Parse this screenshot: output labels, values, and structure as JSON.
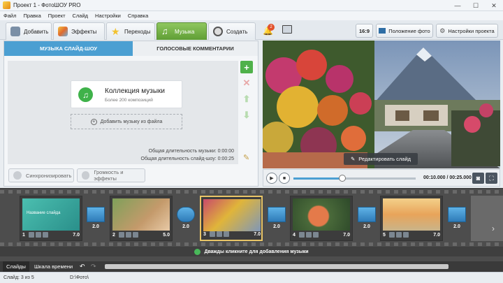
{
  "window": {
    "title": "Проект 1 - ФотоШОУ PRO",
    "minimize": "—",
    "maximize": "☐",
    "close": "✕"
  },
  "menu": [
    "Файл",
    "Правка",
    "Проект",
    "Слайд",
    "Настройки",
    "Справка"
  ],
  "tabs": [
    {
      "label": "Добавить",
      "icon": "add-photo-icon"
    },
    {
      "label": "Эффекты",
      "icon": "effects-icon"
    },
    {
      "label": "Переходы",
      "icon": "transitions-star-icon"
    },
    {
      "label": "Музыка",
      "icon": "music-icon",
      "active": true
    },
    {
      "label": "Создать",
      "icon": "create-film-icon"
    }
  ],
  "toolbar": {
    "notifications_badge": "2",
    "aspect_label": "16:9",
    "photo_position_label": "Положение фото",
    "project_settings_label": "Настройки проекта"
  },
  "music_panel": {
    "subtab_music": "МУЗЫКА СЛАЙД-ШОУ",
    "subtab_voice": "ГОЛОСОВЫЕ КОММЕНТАРИИ",
    "collection_title": "Коллекция музыки",
    "collection_subtitle": "Более 200 композиций",
    "add_file_label": "Добавить музыку из файла",
    "total_music_duration": "Общая длительность музыки: 0:00:00",
    "total_slideshow_duration": "Общая длительность слайд-шоу: 0:00:25",
    "sync_label": "Синхронизировать",
    "volume_label": "Громкость и эффекты"
  },
  "preview": {
    "edit_slide_label": "Редактировать слайд",
    "time_display": "00:10.000 / 00:25.000",
    "progress": 0.4
  },
  "timeline": {
    "slides": [
      {
        "number": "1",
        "duration": "7.0",
        "caption": "Название слайда"
      },
      {
        "number": "2",
        "duration": "5.0"
      },
      {
        "number": "3",
        "duration": "7.0"
      },
      {
        "number": "4",
        "duration": "7.0"
      },
      {
        "number": "5",
        "duration": "7.0"
      }
    ],
    "transitions": [
      "2.0",
      "2.0",
      "2.0",
      "2.0",
      "2.0"
    ],
    "music_hint": "Дважды кликните для добавления музыки"
  },
  "bottom_tabs": [
    "Слайды",
    "Шкала времени"
  ],
  "status": {
    "slide_counter": "Слайд: 3 из 5",
    "path": "D:\\Фото\\"
  }
}
